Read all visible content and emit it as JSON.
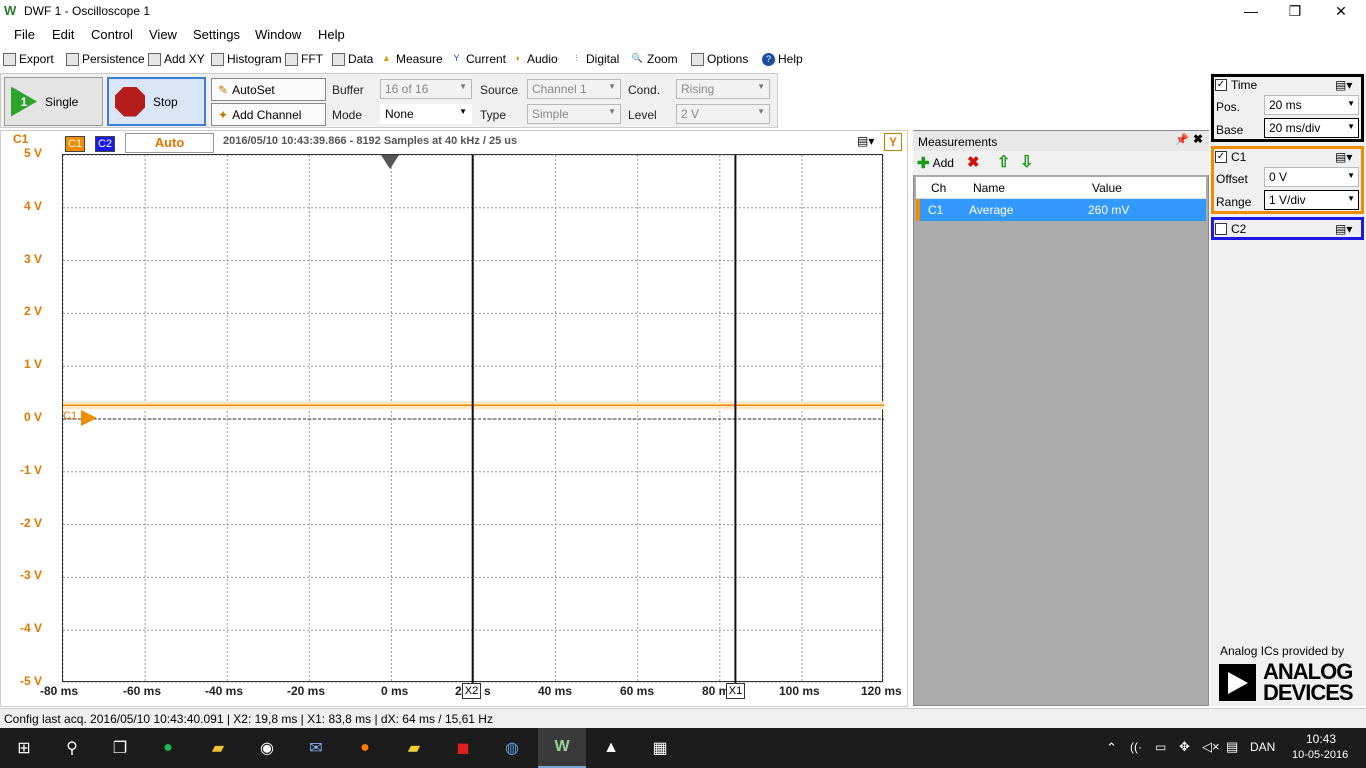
{
  "window": {
    "title": "DWF 1 - Oscilloscope 1",
    "min": "—",
    "restore": "❐",
    "close": "✕"
  },
  "menu": [
    "File",
    "Edit",
    "Control",
    "View",
    "Settings",
    "Window",
    "Help"
  ],
  "toolbar": [
    "Export",
    "Persistence",
    "Add XY",
    "Histogram",
    "FFT",
    "Data",
    "Measure",
    "Current",
    "Audio",
    "Digital",
    "Zoom",
    "Options",
    "Help"
  ],
  "controls": {
    "single": "Single",
    "stop": "Stop",
    "autoset": "AutoSet",
    "add_channel": "Add Channel",
    "buffer_label": "Buffer",
    "buffer_value": "16 of 16",
    "mode_label": "Mode",
    "mode_value": "None",
    "source_label": "Source",
    "source_value": "Channel 1",
    "type_label": "Type",
    "type_value": "Simple",
    "cond_label": "Cond.",
    "cond_value": "Rising",
    "level_label": "Level",
    "level_value": "2 V"
  },
  "scope": {
    "channel_label": "C1",
    "tag_c1": "C1",
    "tag_c2": "C2",
    "trigger_mode": "Auto",
    "acq_info": "2016/05/10  10:43:39.866 - 8192 Samples at 40 kHz / 25 us",
    "y_button": "Y",
    "c1_marker": "C1",
    "cursor_x1": "X1",
    "cursor_x2": "X2",
    "y_ticks": [
      "5 V",
      "4 V",
      "3 V",
      "2 V",
      "1 V",
      "0 V",
      "-1 V",
      "-2 V",
      "-3 V",
      "-4 V",
      "-5 V"
    ],
    "x_ticks": [
      "-80 ms",
      "-60 ms",
      "-40 ms",
      "-20 ms",
      "0 ms",
      "2",
      "s",
      "40 ms",
      "60 ms",
      "80 m",
      "100 ms",
      "120 ms"
    ],
    "signal_level_v": 0.26,
    "trigger_pos_ms": 0,
    "x2_ms": 19.8,
    "x1_ms": 83.8
  },
  "measurements": {
    "title": "Measurements",
    "add": "Add",
    "columns": [
      "Ch",
      "Name",
      "Value"
    ],
    "rows": [
      {
        "ch": "C1",
        "name": "Average",
        "value": "260 mV"
      }
    ]
  },
  "right": {
    "time_label": "Time",
    "pos_label": "Pos.",
    "pos_value": "20 ms",
    "base_label": "Base",
    "base_value": "20 ms/div",
    "c1_label": "C1",
    "offset_label": "Offset",
    "offset_value": "0 V",
    "range_label": "Range",
    "range_value": "1 V/div",
    "c2_label": "C2",
    "ad_text": "Analog ICs provided by",
    "ad_brand1": "ANALOG",
    "ad_brand2": "DEVICES"
  },
  "status": "Config last acq. 2016/05/10  10:43:40.091  |  X2: 19,8 ms | X1: 83,8 ms | dX: 64 ms / 15,61 Hz",
  "taskbar": {
    "lang": "DAN",
    "time": "10:43",
    "date": "10-05-2016"
  },
  "colors": {
    "c1": "#f08c00",
    "c2": "#1a1ae6",
    "selected_row": "#3399ff"
  }
}
